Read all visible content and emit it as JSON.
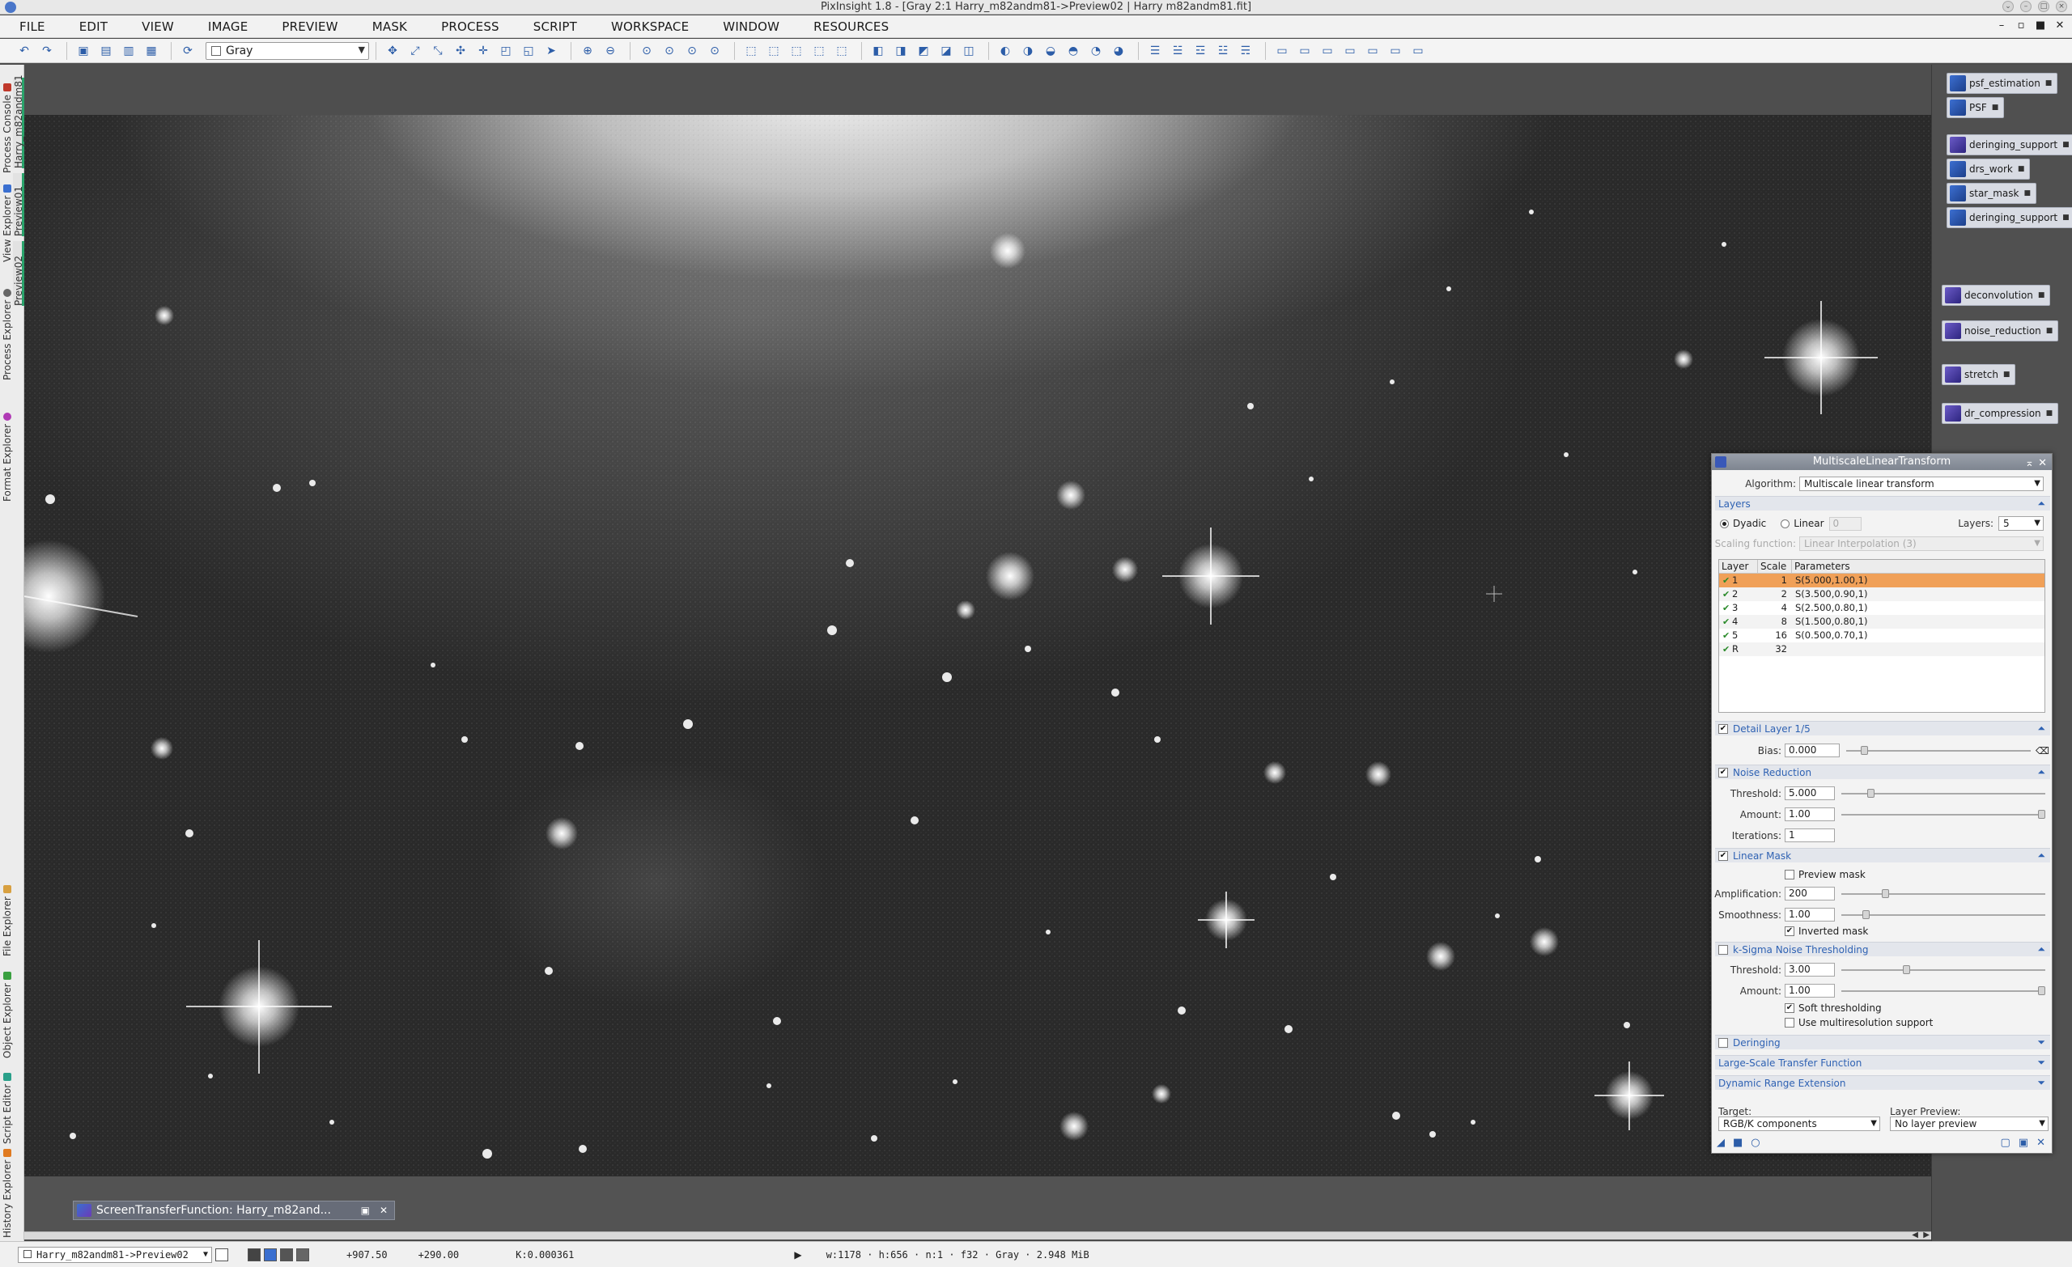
{
  "window": {
    "title": "PixInsight 1.8 - [Gray 2:1 Harry_m82andm81->Preview02 | Harry m82andm81.fit]"
  },
  "menu": [
    "FILE",
    "EDIT",
    "VIEW",
    "IMAGE",
    "PREVIEW",
    "MASK",
    "PROCESS",
    "SCRIPT",
    "WORKSPACE",
    "WINDOW",
    "RESOURCES"
  ],
  "toolbar": {
    "channel_combo": "Gray"
  },
  "left_dock": {
    "tabs_top": [
      "Process Console",
      "View Explorer",
      "Process Explorer",
      "Format Explorer"
    ],
    "view_tabs": [
      "Harry_m82andm81",
      "Preview01",
      "Preview02"
    ],
    "tabs_bottom": [
      "File Explorer",
      "Object Explorer",
      "Script Editor",
      "History Explorer"
    ]
  },
  "right_dock": {
    "icons": [
      "psf_estimation",
      "PSF",
      "deringing_support",
      "drs_work",
      "star_mask",
      "deringing_support",
      "deconvolution",
      "noise_reduction",
      "stretch",
      "dr_compression"
    ]
  },
  "mlt": {
    "title": "MultiscaleLinearTransform",
    "algorithm_label": "Algorithm:",
    "algorithm_value": "Multiscale linear transform",
    "layers_section": "Layers",
    "dyadic_label": "Dyadic",
    "linear_label": "Linear",
    "linear_value": "0",
    "layers_label": "Layers:",
    "layers_value": "5",
    "scaling_label": "Scaling function:",
    "scaling_value": "Linear Interpolation (3)",
    "table_headers": [
      "Layer",
      "Scale",
      "Parameters"
    ],
    "table_rows": [
      {
        "layer": "1",
        "scale": "1",
        "params": "S(5.000,1.00,1)"
      },
      {
        "layer": "2",
        "scale": "2",
        "params": "S(3.500,0.90,1)"
      },
      {
        "layer": "3",
        "scale": "4",
        "params": "S(2.500,0.80,1)"
      },
      {
        "layer": "4",
        "scale": "8",
        "params": "S(1.500,0.80,1)"
      },
      {
        "layer": "5",
        "scale": "16",
        "params": "S(0.500,0.70,1)"
      },
      {
        "layer": "R",
        "scale": "32",
        "params": ""
      }
    ],
    "detail_section": "Detail Layer 1/5",
    "bias_label": "Bias:",
    "bias_value": "0.000",
    "noise_section": "Noise Reduction",
    "nr_threshold_label": "Threshold:",
    "nr_threshold_value": "5.000",
    "nr_amount_label": "Amount:",
    "nr_amount_value": "1.00",
    "nr_iterations_label": "Iterations:",
    "nr_iterations_value": "1",
    "mask_section": "Linear Mask",
    "preview_mask_label": "Preview mask",
    "amplification_label": "Amplification:",
    "amplification_value": "200",
    "smoothness_label": "Smoothness:",
    "smoothness_value": "1.00",
    "inverted_mask_label": "Inverted mask",
    "ksigma_section": "k-Sigma Noise Thresholding",
    "ks_threshold_label": "Threshold:",
    "ks_threshold_value": "3.00",
    "ks_amount_label": "Amount:",
    "ks_amount_value": "1.00",
    "soft_thresholding_label": "Soft thresholding",
    "multires_label": "Use multiresolution support",
    "deringing_section": "Deringing",
    "lstf_section": "Large-Scale Transfer Function",
    "dre_section": "Dynamic Range Extension",
    "target_label": "Target:",
    "target_value": "RGB/K components",
    "layer_preview_label": "Layer Preview:",
    "layer_preview_value": "No layer preview"
  },
  "stf": {
    "title": "ScreenTransferFunction: Harry_m82and..."
  },
  "status": {
    "view": "Harry_m82andm81->Preview02",
    "x": "+907.50",
    "y": "+290.00",
    "k": "K:0.000361",
    "info": "w:1178 · h:656 · n:1 · f32 · Gray · 2.948 MiB"
  }
}
